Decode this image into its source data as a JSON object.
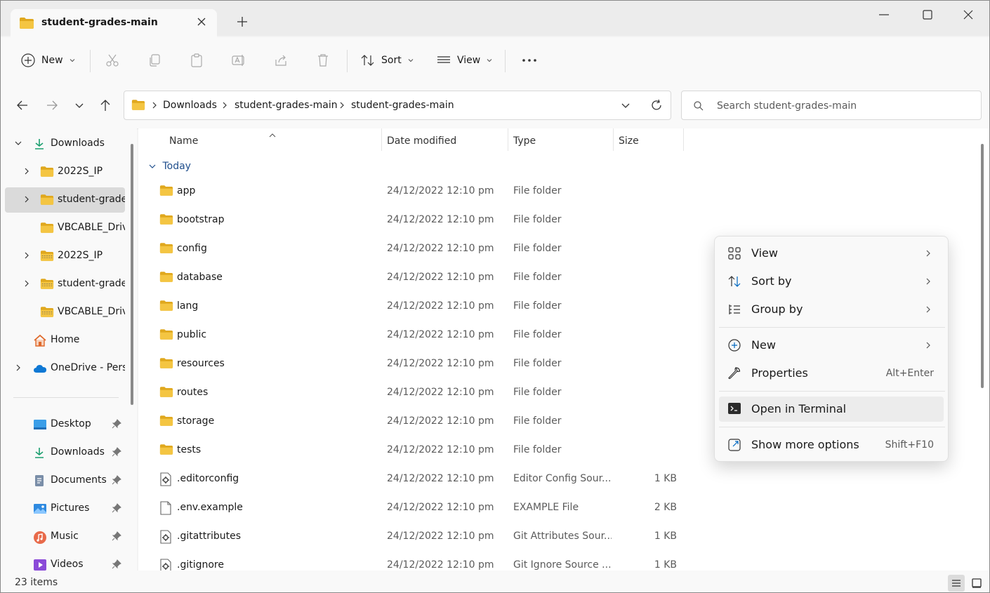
{
  "window": {
    "tab_title": "student-grades-main",
    "minimize_label": "",
    "maximize_label": "",
    "close_label": ""
  },
  "toolbar": {
    "new_label": "New",
    "sort_label": "Sort",
    "view_label": "View"
  },
  "address": {
    "segments": [
      "Downloads",
      "student-grades-main",
      "student-grades-main"
    ],
    "search_placeholder": "Search student-grades-main"
  },
  "sidebar": {
    "items": [
      {
        "label": "Downloads",
        "icon": "download-icon",
        "chevron": "down"
      },
      {
        "label": "2022S_IP",
        "icon": "folder-icon",
        "chevron": "right"
      },
      {
        "label": "student-grades-main",
        "icon": "folder-icon",
        "chevron": "right",
        "selected": true
      },
      {
        "label": "VBCABLE_Driver_Pack",
        "icon": "folder-icon",
        "chevron": ""
      },
      {
        "label": "2022S_IP",
        "icon": "zip-folder-icon",
        "chevron": "right"
      },
      {
        "label": "student-grades-main",
        "icon": "zip-folder-icon",
        "chevron": "right"
      },
      {
        "label": "VBCABLE_Driver_Pack",
        "icon": "zip-folder-icon",
        "chevron": ""
      },
      {
        "label": "Home",
        "icon": "home-icon",
        "chevron": ""
      },
      {
        "label": "OneDrive - Personal",
        "icon": "cloud-icon",
        "chevron": "right"
      }
    ],
    "quick_access": [
      {
        "label": "Desktop",
        "icon": "desktop-icon"
      },
      {
        "label": "Downloads",
        "icon": "download-icon"
      },
      {
        "label": "Documents",
        "icon": "document-icon"
      },
      {
        "label": "Pictures",
        "icon": "pictures-icon"
      },
      {
        "label": "Music",
        "icon": "music-icon"
      },
      {
        "label": "Videos",
        "icon": "videos-icon"
      }
    ]
  },
  "columns": {
    "name": "Name",
    "date": "Date modified",
    "type": "Type",
    "size": "Size"
  },
  "group_label": "Today",
  "files": [
    {
      "name": "app",
      "date": "24/12/2022 12:10 pm",
      "type": "File folder",
      "size": "",
      "kind": "folder"
    },
    {
      "name": "bootstrap",
      "date": "24/12/2022 12:10 pm",
      "type": "File folder",
      "size": "",
      "kind": "folder"
    },
    {
      "name": "config",
      "date": "24/12/2022 12:10 pm",
      "type": "File folder",
      "size": "",
      "kind": "folder"
    },
    {
      "name": "database",
      "date": "24/12/2022 12:10 pm",
      "type": "File folder",
      "size": "",
      "kind": "folder"
    },
    {
      "name": "lang",
      "date": "24/12/2022 12:10 pm",
      "type": "File folder",
      "size": "",
      "kind": "folder"
    },
    {
      "name": "public",
      "date": "24/12/2022 12:10 pm",
      "type": "File folder",
      "size": "",
      "kind": "folder"
    },
    {
      "name": "resources",
      "date": "24/12/2022 12:10 pm",
      "type": "File folder",
      "size": "",
      "kind": "folder"
    },
    {
      "name": "routes",
      "date": "24/12/2022 12:10 pm",
      "type": "File folder",
      "size": "",
      "kind": "folder"
    },
    {
      "name": "storage",
      "date": "24/12/2022 12:10 pm",
      "type": "File folder",
      "size": "",
      "kind": "folder"
    },
    {
      "name": "tests",
      "date": "24/12/2022 12:10 pm",
      "type": "File folder",
      "size": "",
      "kind": "folder"
    },
    {
      "name": ".editorconfig",
      "date": "24/12/2022 12:10 pm",
      "type": "Editor Config Sour...",
      "size": "1 KB",
      "kind": "config"
    },
    {
      "name": ".env.example",
      "date": "24/12/2022 12:10 pm",
      "type": "EXAMPLE File",
      "size": "2 KB",
      "kind": "file"
    },
    {
      "name": ".gitattributes",
      "date": "24/12/2022 12:10 pm",
      "type": "Git Attributes Sour...",
      "size": "1 KB",
      "kind": "config"
    },
    {
      "name": ".gitignore",
      "date": "24/12/2022 12:10 pm",
      "type": "Git Ignore Source ...",
      "size": "1 KB",
      "kind": "config"
    }
  ],
  "status": {
    "count": "23 items"
  },
  "context_menu": {
    "view": "View",
    "sort_by": "Sort by",
    "group_by": "Group by",
    "new": "New",
    "properties": "Properties",
    "properties_shortcut": "Alt+Enter",
    "open_terminal": "Open in Terminal",
    "more_options": "Show more options",
    "more_options_shortcut": "Shift+F10"
  },
  "colors": {
    "accent": "#0067c0",
    "folder": "#f4c542",
    "folder_dark": "#e0a81e",
    "onedrive": "#0f78d4"
  }
}
